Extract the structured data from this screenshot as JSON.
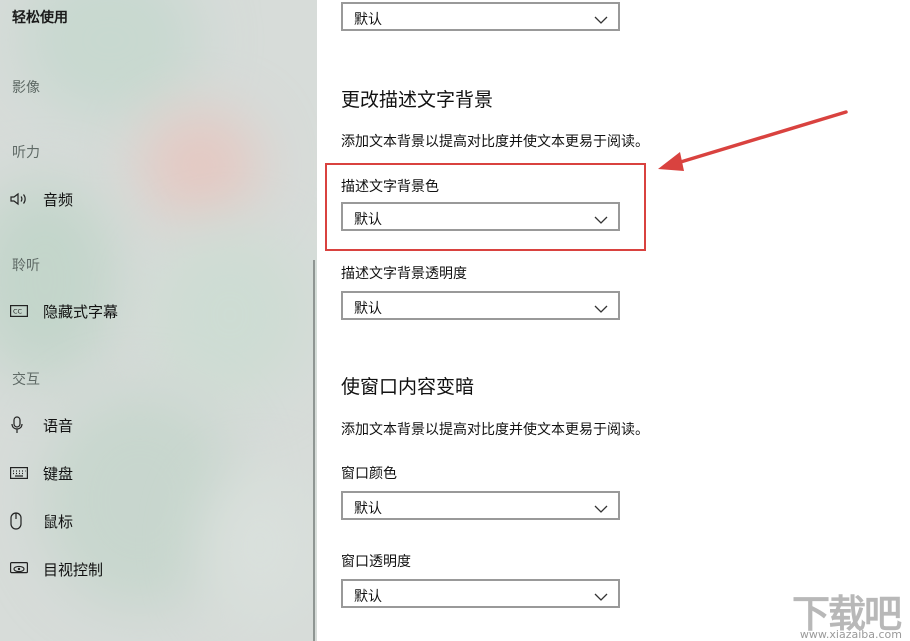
{
  "sidebar": {
    "app_title": "轻松使用",
    "groups": {
      "image": "影像",
      "hearing": "听力",
      "listen": "聆听",
      "interaction": "交互"
    },
    "items": [
      {
        "label": "音频",
        "icon": "speaker-icon"
      },
      {
        "label": "隐藏式字幕",
        "icon": "closed-caption-icon"
      },
      {
        "label": "语音",
        "icon": "microphone-icon"
      },
      {
        "label": "键盘",
        "icon": "keyboard-icon"
      },
      {
        "label": "鼠标",
        "icon": "mouse-icon"
      },
      {
        "label": "目视控制",
        "icon": "eye-control-icon"
      }
    ]
  },
  "main": {
    "top_select": {
      "value": "默认"
    },
    "section_bg": {
      "heading": "更改描述文字背景",
      "description": "添加文本背景以提高对比度并使文本更易于阅读。",
      "color_label": "描述文字背景色",
      "color_value": "默认",
      "opacity_label": "描述文字背景透明度",
      "opacity_value": "默认"
    },
    "section_window": {
      "heading": "使窗口内容变暗",
      "description": "添加文本背景以提高对比度并使文本更易于阅读。",
      "color_label": "窗口颜色",
      "color_value": "默认",
      "opacity_label": "窗口透明度",
      "opacity_value": "默认"
    }
  },
  "annotation": {
    "highlight_color": "#d9423f"
  },
  "watermark": {
    "main": "下载吧",
    "sub": "www.xiazaiba.com"
  }
}
